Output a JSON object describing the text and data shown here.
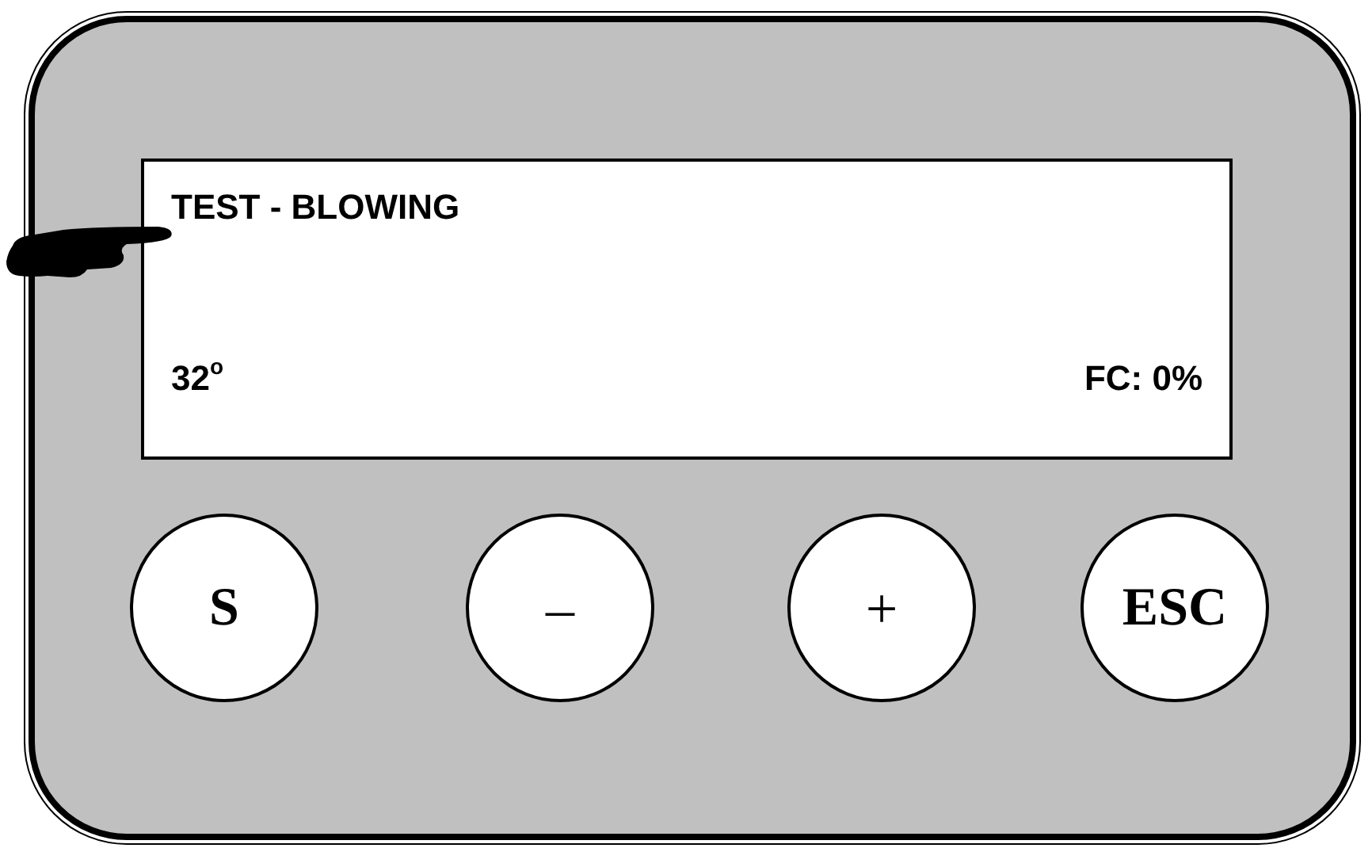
{
  "display": {
    "title": "TEST - BLOWING",
    "temperature": "32$^{o}$",
    "reading": "FC: 0%"
  },
  "buttons": [
    {
      "label": "S"
    },
    {
      "label": "–"
    },
    {
      "label": "+"
    },
    {
      "label": "ESC"
    }
  ]
}
